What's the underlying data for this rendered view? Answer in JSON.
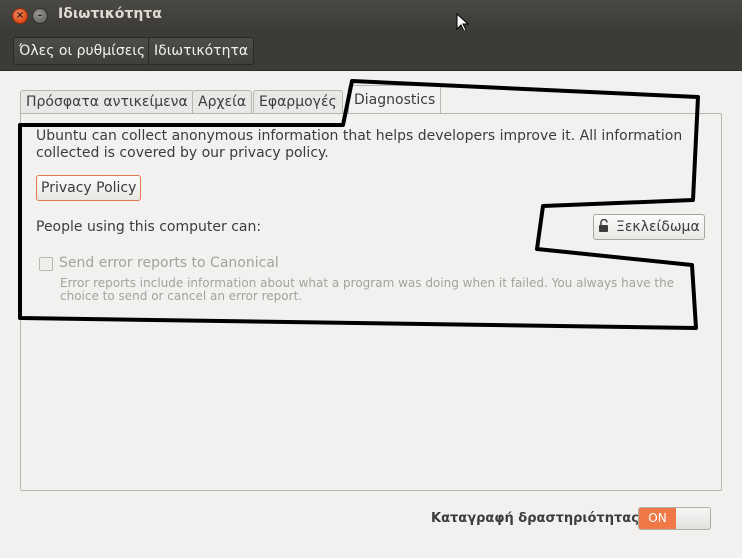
{
  "window": {
    "title": "Ιδιωτικότητα"
  },
  "toolbar": {
    "all_settings": "Όλες οι ρυθμίσεις",
    "current": "Ιδιωτικότητα"
  },
  "tabs": [
    {
      "label": "Πρόσφατα αντικείμενα"
    },
    {
      "label": "Αρχεία"
    },
    {
      "label": "Εφαρμογές"
    },
    {
      "label": "Diagnostics",
      "active": true
    }
  ],
  "diagnostics": {
    "description": "Ubuntu can collect anonymous information that helps developers improve it. All information collected is covered by our privacy policy.",
    "privacy_policy_button": "Privacy Policy",
    "people_label": "People using this computer can:",
    "unlock_button": "Ξεκλείδωμα",
    "send_reports_label": "Send error reports to Canonical",
    "send_reports_checked": false,
    "send_reports_description": "Error reports include information about what a program was doing when it failed. You always have the choice to send or cancel an error report."
  },
  "activity": {
    "label": "Καταγραφή δραστηριότητας",
    "switch_state": "ON"
  },
  "colors": {
    "accent": "#f07746",
    "close": "#df4a16",
    "annotation": "#000000"
  }
}
